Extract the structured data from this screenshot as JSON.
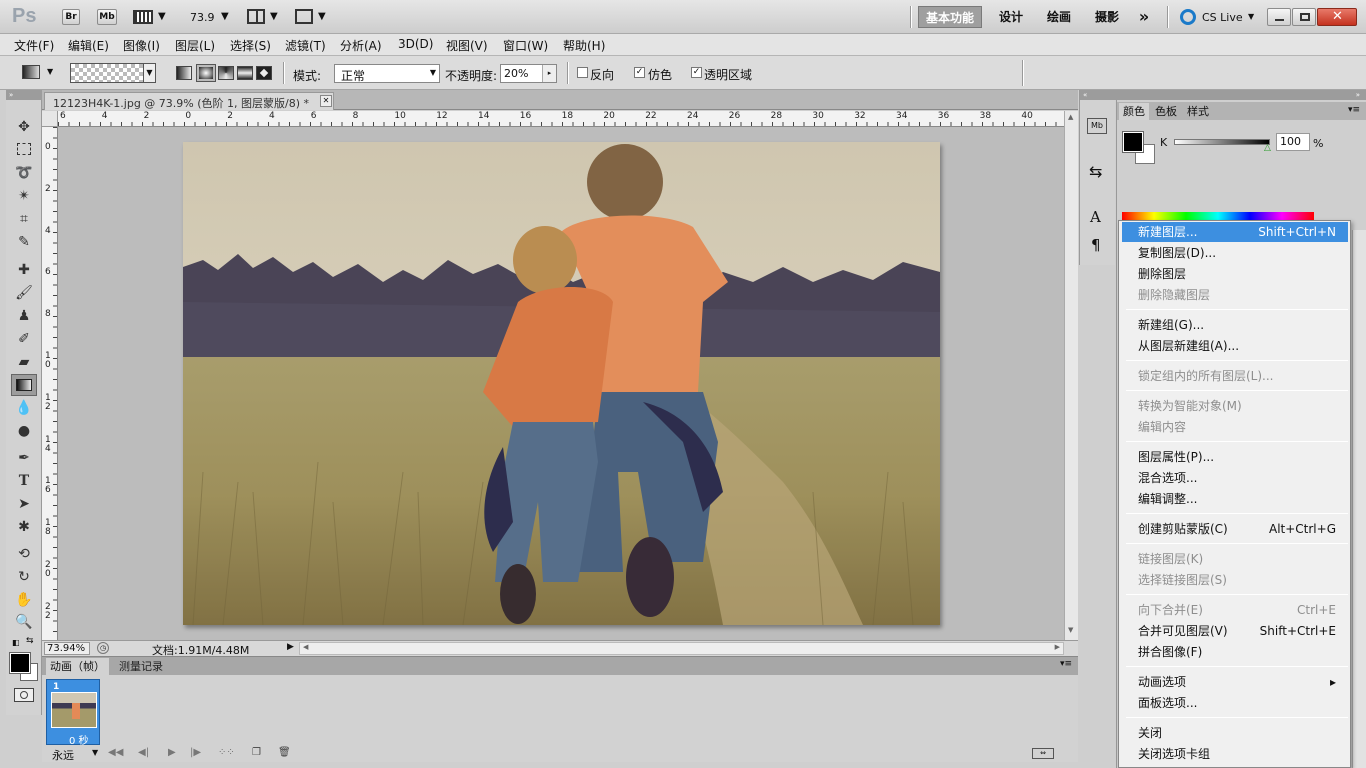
{
  "app": {
    "logo": "Ps",
    "bridge_btn": "Br",
    "minibridge_btn": "Mb",
    "zoom_value": "73.9",
    "workspaces": [
      "基本功能",
      "设计",
      "绘画",
      "摄影"
    ],
    "overflow": "»",
    "cslive": "CS Live"
  },
  "menu": [
    "文件(F)",
    "编辑(E)",
    "图像(I)",
    "图层(L)",
    "选择(S)",
    "滤镜(T)",
    "分析(A)",
    "3D(D)",
    "视图(V)",
    "窗口(W)",
    "帮助(H)"
  ],
  "options": {
    "mode_label": "模式:",
    "mode_value": "正常",
    "opacity_label": "不透明度:",
    "opacity_value": "20%",
    "reverse_label": "反向",
    "dither_label": "仿色",
    "transparency_label": "透明区域"
  },
  "document": {
    "tab_title": "12123H4K-1.jpg @ 73.9% (色阶 1, 图层蒙版/8) *",
    "zoom_status": "73.94%",
    "doc_info": "文档:1.91M/4.48M"
  },
  "rulers": {
    "h": [
      "6",
      "4",
      "2",
      "0",
      "2",
      "4",
      "6",
      "8",
      "10",
      "12",
      "14",
      "16",
      "18",
      "20",
      "22",
      "24",
      "26",
      "28",
      "30",
      "32",
      "34",
      "36",
      "38",
      "40"
    ],
    "v": [
      "0",
      "2",
      "4",
      "6",
      "8",
      "1 0",
      "1 2",
      "1 4",
      "1 6",
      "1 8",
      "2 0",
      "2 2"
    ]
  },
  "panels": {
    "color_tabs": [
      "颜色",
      "色板",
      "样式"
    ],
    "k_label": "K",
    "k_value": "100",
    "pct": "%"
  },
  "timeline": {
    "tabs": [
      "动画（帧）",
      "测量记录"
    ],
    "frame_number": "1",
    "frame_delay": "0 秒",
    "loop": "永远"
  },
  "context_menu": [
    {
      "label": "新建图层...",
      "shortcut": "Shift+Ctrl+N",
      "state": "highlight"
    },
    {
      "label": "复制图层(D)...",
      "shortcut": "",
      "state": "normal"
    },
    {
      "label": "删除图层",
      "shortcut": "",
      "state": "normal"
    },
    {
      "label": "删除隐藏图层",
      "shortcut": "",
      "state": "disabled"
    },
    {
      "label": "新建组(G)...",
      "shortcut": "",
      "state": "normal"
    },
    {
      "label": "从图层新建组(A)...",
      "shortcut": "",
      "state": "normal"
    },
    {
      "label": "锁定组内的所有图层(L)...",
      "shortcut": "",
      "state": "disabled"
    },
    {
      "label": "转换为智能对象(M)",
      "shortcut": "",
      "state": "disabled"
    },
    {
      "label": "编辑内容",
      "shortcut": "",
      "state": "disabled"
    },
    {
      "label": "图层属性(P)...",
      "shortcut": "",
      "state": "normal"
    },
    {
      "label": "混合选项...",
      "shortcut": "",
      "state": "normal"
    },
    {
      "label": "编辑调整...",
      "shortcut": "",
      "state": "normal"
    },
    {
      "label": "创建剪贴蒙版(C)",
      "shortcut": "Alt+Ctrl+G",
      "state": "normal"
    },
    {
      "label": "链接图层(K)",
      "shortcut": "",
      "state": "disabled"
    },
    {
      "label": "选择链接图层(S)",
      "shortcut": "",
      "state": "disabled"
    },
    {
      "label": "向下合并(E)",
      "shortcut": "Ctrl+E",
      "state": "disabled"
    },
    {
      "label": "合并可见图层(V)",
      "shortcut": "Shift+Ctrl+E",
      "state": "normal"
    },
    {
      "label": "拼合图像(F)",
      "shortcut": "",
      "state": "normal"
    },
    {
      "label": "动画选项",
      "shortcut": "▸",
      "state": "normal"
    },
    {
      "label": "面板选项...",
      "shortcut": "",
      "state": "normal"
    },
    {
      "label": "关闭",
      "shortcut": "",
      "state": "normal"
    },
    {
      "label": "关闭选项卡组",
      "shortcut": "",
      "state": "normal"
    }
  ],
  "colors": {
    "highlight": "#3d8fe0",
    "window_close": "#d6402f"
  }
}
